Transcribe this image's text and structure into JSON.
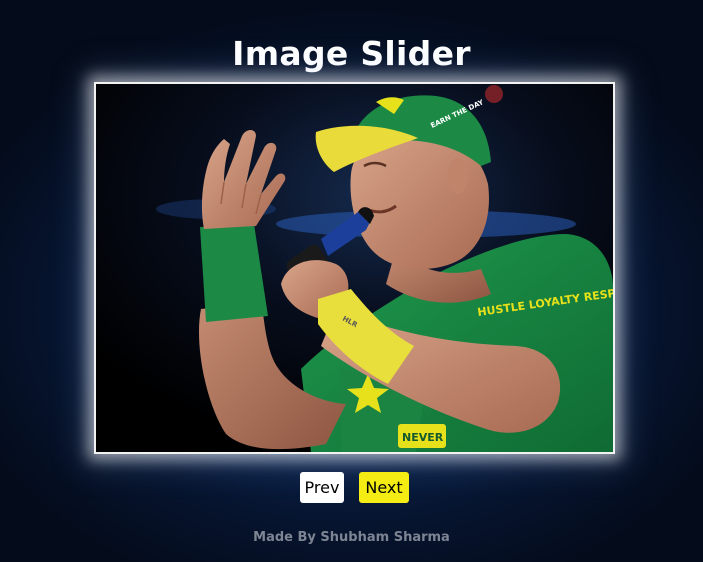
{
  "header": {
    "title": "Image Slider"
  },
  "slider": {
    "image": {
      "cap_text": "EARN THE DAY",
      "shirt_text": "HUSTLE LOYALTY RESPECT",
      "wristband_text": "HLR",
      "shirt_chest_text": "NEVER"
    },
    "prev_label": "Prev",
    "next_label": "Next"
  },
  "footer": {
    "credit": "Made By Shubham Sharma"
  },
  "colors": {
    "background": "#0b2552",
    "prev_button": "#ffffff",
    "next_button": "#f4ec12",
    "title": "#ffffff",
    "footer_text": "#7d8594"
  }
}
